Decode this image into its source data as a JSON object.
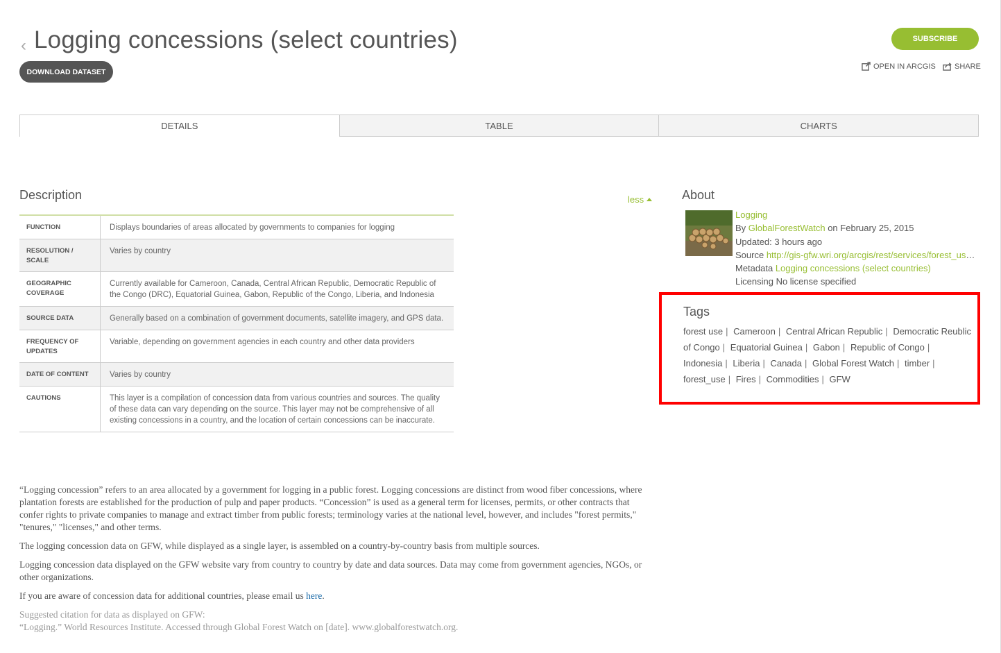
{
  "header": {
    "back_glyph": "‹",
    "title": "Logging concessions (select countries)",
    "download_label": "DOWNLOAD DATASET",
    "subscribe_label": "SUBSCRIBE",
    "open_arcgis_label": "OPEN IN ARCGIS",
    "share_label": "SHARE"
  },
  "tabs": [
    {
      "label": "DETAILS",
      "active": true
    },
    {
      "label": "TABLE",
      "active": false
    },
    {
      "label": "CHARTS",
      "active": false
    }
  ],
  "description": {
    "heading": "Description",
    "toggle_label": "less",
    "rows": [
      {
        "key": "FUNCTION",
        "value": "Displays boundaries of areas allocated by governments to companies for logging"
      },
      {
        "key": "RESOLUTION / SCALE",
        "value": "Varies by country"
      },
      {
        "key": "GEOGRAPHIC COVERAGE",
        "value": "Currently available for Cameroon, Canada, Central African Republic, Democratic Republic of the Congo (DRC), Equatorial Guinea, Gabon, Republic of the Congo, Liberia, and Indonesia"
      },
      {
        "key": "SOURCE DATA",
        "value": "Generally based on a combination of government documents, satellite imagery, and GPS data."
      },
      {
        "key": "FREQUENCY OF UPDATES",
        "value": "Variable, depending on government agencies in each country and other data providers"
      },
      {
        "key": "DATE OF CONTENT",
        "value": "Varies by country"
      },
      {
        "key": "CAUTIONS",
        "value": "This layer is a compilation of concession data from various countries and sources. The quality of these data can vary depending on the source. This layer may not be comprehensive of all existing concessions in a country, and the location of certain concessions can be inaccurate."
      }
    ],
    "paragraph1": "“Logging concession” refers to an area allocated by a government for logging in a public forest. Logging concessions are distinct from wood fiber concessions, where plantation forests are established for the production of pulp and paper products. “Concession” is used as a general term for licenses, permits, or other contracts that confer rights to private companies to manage and extract timber from public forests; terminology varies at the national level, however, and includes \"forest permits,\" \"tenures,\" \"licenses,\" and other terms.",
    "paragraph2": "The logging concession data on GFW, while displayed as a single layer, is assembled on a country-by-country basis from multiple sources.",
    "paragraph3": "Logging concession data displayed on the GFW website vary from country to country by date and data sources. Data may come from government agencies, NGOs, or other organizations.",
    "paragraph4_text": "If you are aware of concession data for additional countries, please email us ",
    "paragraph4_link": "here",
    "paragraph4_end": ".",
    "citation_line1": "Suggested citation for data as displayed on GFW:",
    "citation_line2": "“Logging.” World Resources Institute. Accessed through Global Forest Watch on [date]. www.globalforestwatch.org."
  },
  "about": {
    "heading": "About",
    "item_name": "Logging",
    "by_label": "By",
    "author": "GlobalForestWatch",
    "date_text": "on February 25, 2015",
    "updated_label": "Updated:",
    "updated_value": "3 hours ago",
    "source_label": "Source",
    "source_url": "http://gis-gfw.wri.org/arcgis/rest/services/forest_use/MapServer",
    "metadata_label": "Metadata",
    "metadata_link": "Logging concessions (select countries)",
    "licensing_label": "Licensing",
    "licensing_value": "No license specified"
  },
  "tags": {
    "heading": "Tags",
    "items": [
      "forest use",
      "Cameroon",
      "Central African Republic",
      "Democratic Reublic of Congo",
      "Equatorial Guinea",
      "Gabon",
      "Republic of Congo",
      "Indonesia",
      "Liberia",
      "Canada",
      "Global Forest Watch",
      "timber",
      "forest_use",
      "Fires",
      "Commodities",
      "GFW"
    ]
  },
  "colors": {
    "accent_green": "#97be32",
    "highlight_red": "#ff0000",
    "dark_button": "#555555",
    "link_blue": "#1a6aa8"
  },
  "icons": {
    "open_arcgis": "external-link-icon",
    "share": "share-icon",
    "toggle": "caret-up-icon"
  }
}
